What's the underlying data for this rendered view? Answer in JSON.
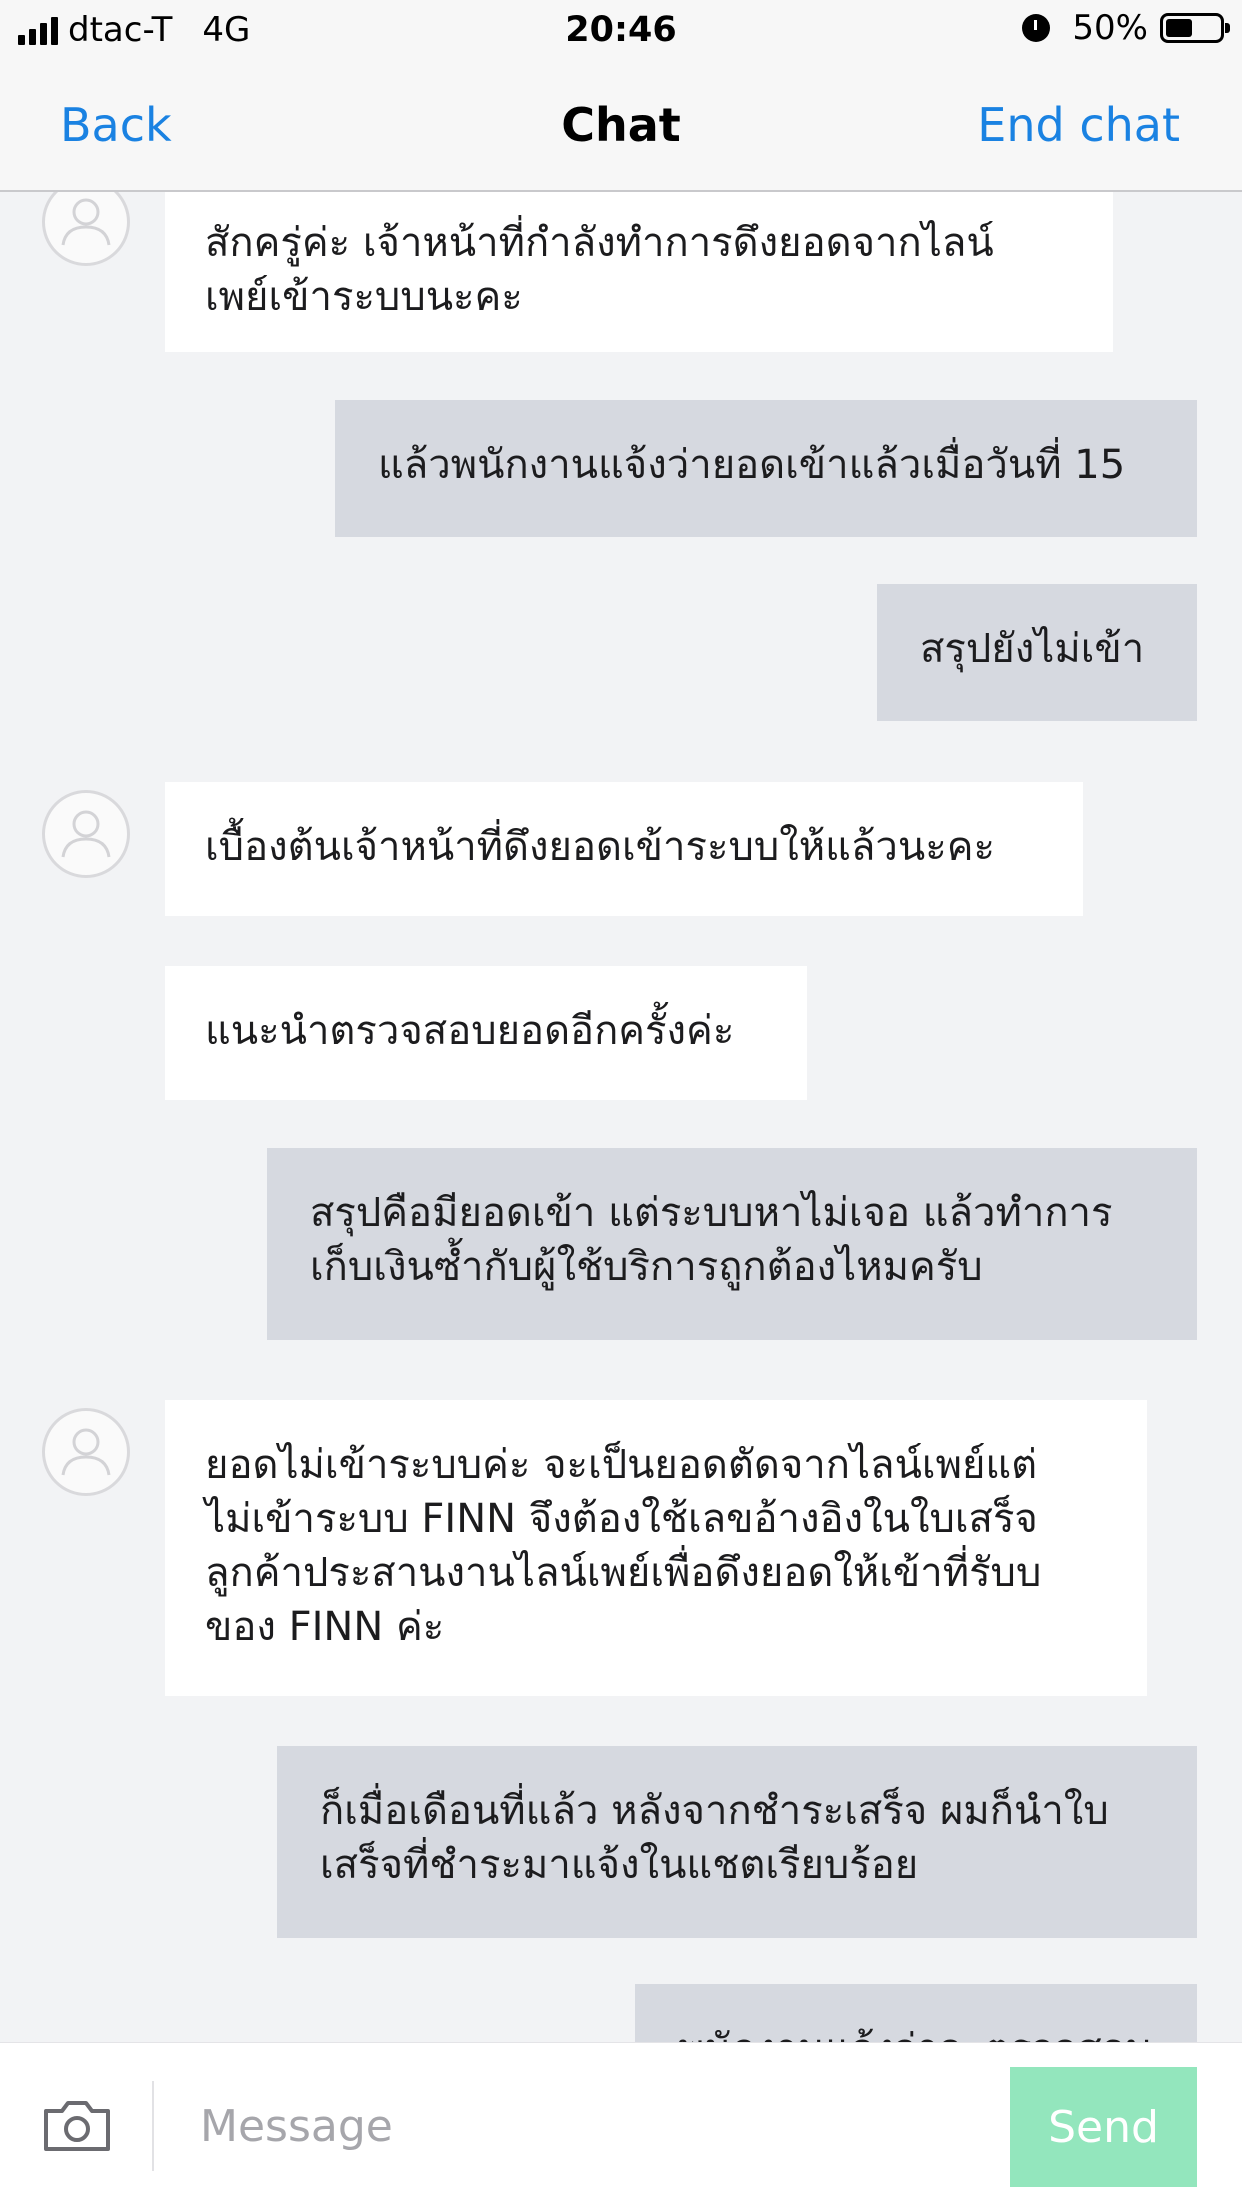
{
  "status_bar": {
    "carrier": "dtac-T",
    "network": "4G",
    "time": "20:46",
    "battery": "50%",
    "battery_level": 0.5,
    "icons": [
      "signal-icon",
      "alarm-icon",
      "battery-icon"
    ]
  },
  "nav": {
    "back_label": "Back",
    "title": "Chat",
    "end_label": "End chat"
  },
  "messages": [
    {
      "sender": "agent",
      "lines": [
        "สักครู่ค่ะ  เจ้าหน้าที่กำลังทำการดึงยอดจากไลน์",
        "เพย์เข้าระบบนะคะ"
      ]
    },
    {
      "sender": "user",
      "lines": [
        "แล้วพนักงานแจ้งว่ายอดเข้าแล้วเมื่อวันที่ 15"
      ]
    },
    {
      "sender": "user",
      "lines": [
        "สรุปยังไม่เข้า"
      ]
    },
    {
      "sender": "agent",
      "lines": [
        "เบื้องต้นเจ้าหน้าที่ดึงยอดเข้าระบบให้แล้วนะคะ"
      ]
    },
    {
      "sender": "agent",
      "lines": [
        "แนะนำตรวจสอบยอดอีกครั้งค่ะ"
      ]
    },
    {
      "sender": "user",
      "lines": [
        "สรุปคือมียอดเข้า แต่ระบบหาไม่เจอ แล้วทำการ",
        "เก็บเงินซ้ำกับผู้ใช้บริการถูกต้องไหมครับ"
      ]
    },
    {
      "sender": "agent",
      "lines": [
        "ยอดไม่เข้าระบบค่ะ  จะเป็นยอดตัดจากไลน์เพย์แต่",
        "ไม่เข้าระบบ FINN  จึงต้องใช้เลขอ้างอิงในใบเสร็จ",
        "ลูกค้าประสานงานไลน์เพย์เพื่อดึงยอดให้เข้าที่รับบ",
        "ของ FINN ค่ะ"
      ]
    },
    {
      "sender": "user",
      "lines": [
        "ก็เมื่อเดือนที่แล้ว หลังจากชำระเสร็จ ผมก็นำใบ",
        "เสร็จที่ชำระมาแจ้งในแชตเรียบร้อย"
      ]
    },
    {
      "sender": "user",
      "lines": [
        "พนักงานแจ้งว่าจะตรวจสอบให้"
      ]
    }
  ],
  "input": {
    "placeholder": "Message",
    "value": "",
    "send_label": "Send",
    "camera_icon": "camera-icon"
  },
  "colors": {
    "accent": "#1a82e2",
    "user_bubble": "#d6d9e0",
    "agent_bubble": "#ffffff",
    "send_button": "#93e6bd",
    "background": "#f2f3f5"
  }
}
